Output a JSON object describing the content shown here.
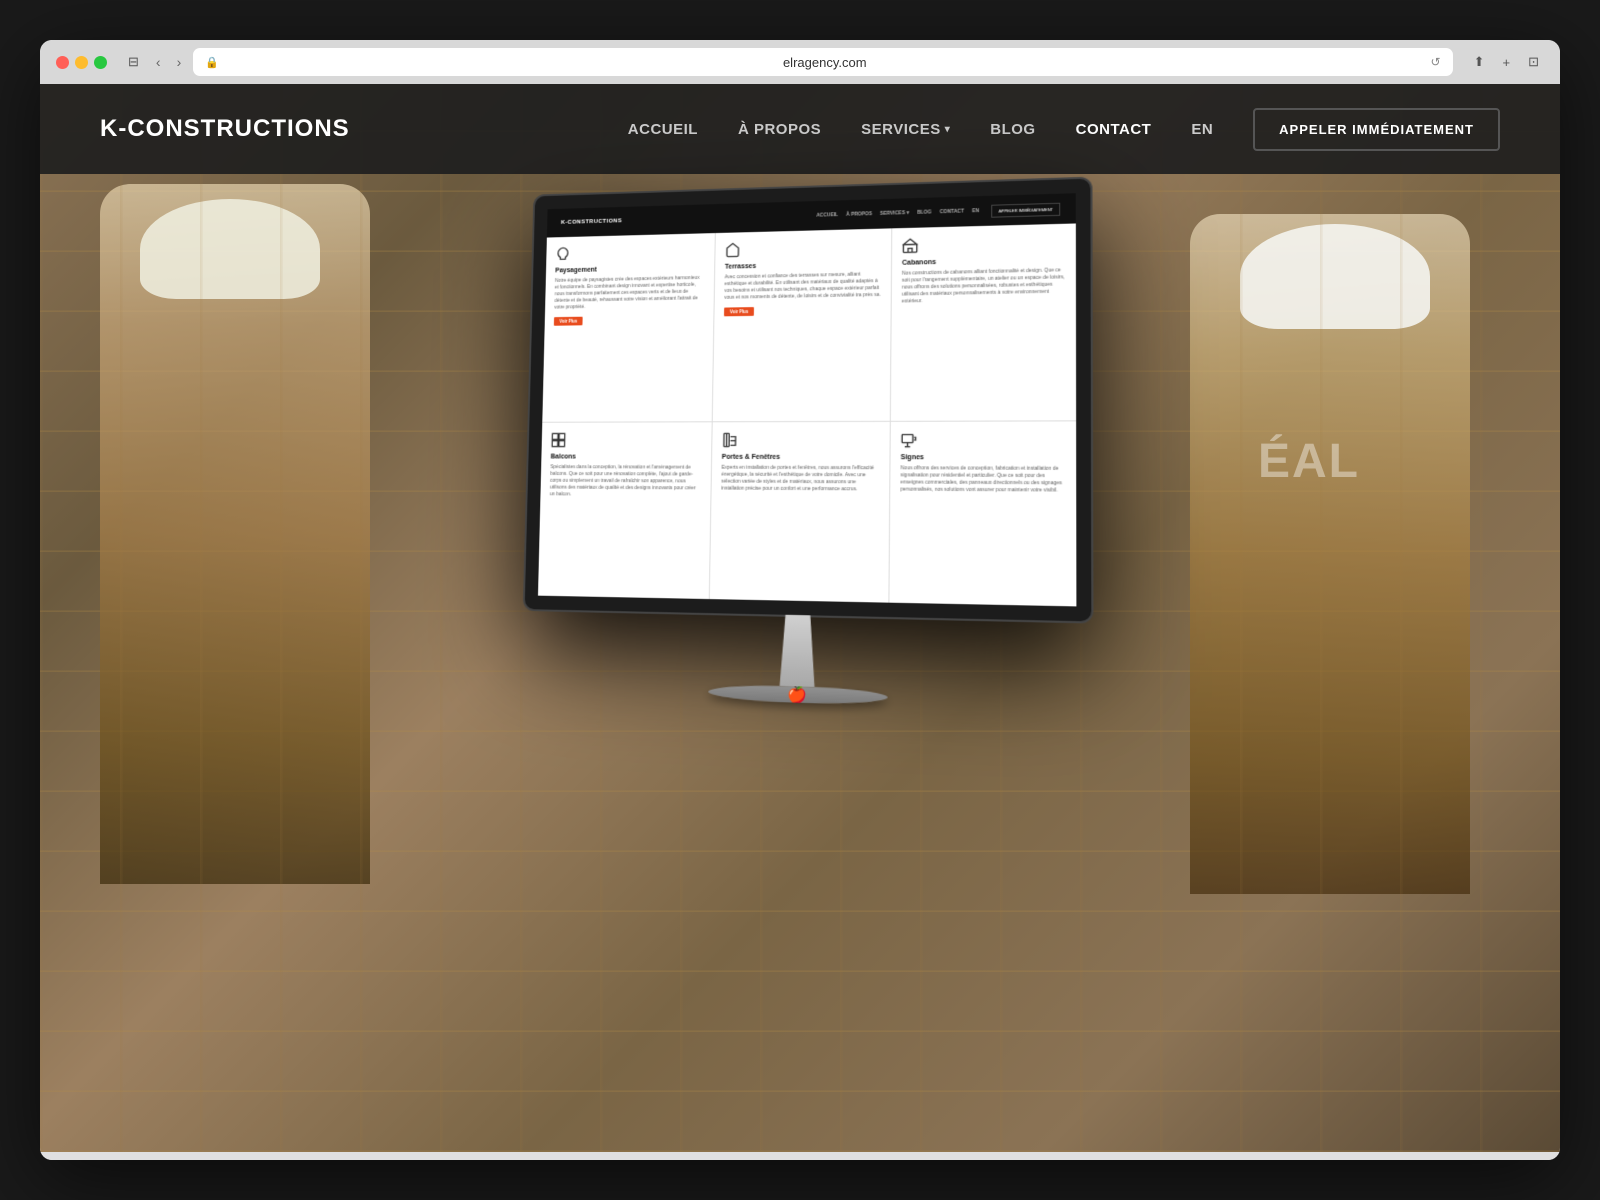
{
  "browser": {
    "url": "elragency.com",
    "traffic_lights": [
      "red",
      "yellow",
      "green"
    ]
  },
  "site": {
    "logo": "K-CONSTRUCTIONS",
    "nav": {
      "accueil": "ACCUEIL",
      "a_propos": "À PROPOS",
      "services": "SERVICES",
      "blog": "BLOG",
      "contact": "CONTACT",
      "lang": "EN"
    },
    "cta_button": "APPELER IMMÉDIATEMENT"
  },
  "inner_site": {
    "logo": "K-CONSTRUCTIONS",
    "nav_links": [
      "ACCUEIL",
      "À PROPOS",
      "SERVICES",
      "BLOG",
      "CONTACT",
      "EN"
    ],
    "cta": "APPELER IMMÉDIATEMENT",
    "services": [
      {
        "title": "Paysagement",
        "icon": "🌿",
        "text": "Notre équipe de paysagistes crée des espaces extérieurs harmonieux et fonctionnels. En combinant design innovant et expertise horticole, nous transformons parfaitement ces espaces verts et de lieux de détente et de beauté, rehaussant votre vision et améliorant l'attrait de votre propriété.",
        "has_btn": true
      },
      {
        "title": "Terrasses",
        "icon": "🏠",
        "text": "Avec concession et confiance des terrasses sur mesure, alliant esthétique et durabilité. En utilisant des matériaux de qualité adaptés à vos besoins et utilisant nos techniques, chaque espace extérieur parfait vous et nos moments de détente, de loisirs et de convivialité tra près sa.",
        "has_btn": true
      },
      {
        "title": "Cabanons",
        "icon": "🏚️",
        "text": "Nos constructions de cabanons alliant fonctionnalité et design. Que ce soit pour l'rangement supplémentaire, un atelier ou un espace de loisirs, nous offrons des solutions personnalisées, robustes et esthétiques utilisant des matériaux personnalisements à votre environnement extérieur.",
        "has_btn": false
      },
      {
        "title": "Balcons",
        "icon": "⊞",
        "text": "Spécialistes dans la conception, la rénovation et l'aménagement de balcons. Que ce soit pour une rénovation complète, l'ajout de garde-corps ou simplement un travail de rafraîchir son apparence, nous utilisons des matériaux de qualité et des designs innovants pour créer un balcon.",
        "has_btn": false
      },
      {
        "title": "Portes & Fenêtres",
        "icon": "🚪",
        "text": "Experts en installation de portes et fenêtres, nous assurons l'efficacité énergétique, la sécurité et l'esthétique de votre domicile. Avec une sélection variée de styles et de matériaux, nous assurons une installation précise pour un confort et une performance accrus.",
        "has_btn": false
      },
      {
        "title": "Signes",
        "icon": "📋",
        "text": "Nous offrons des services de conception, fabrication et installation de signalisation pour résidentiel et particulier. Que ce soit pour des enseignes commerciales, des panneaux directionnels ou des signages personnalisés, nos solutions vont assurer pour maintenir votre visibil.",
        "has_btn": false
      }
    ]
  },
  "monitor": {
    "stand_visible": true
  }
}
